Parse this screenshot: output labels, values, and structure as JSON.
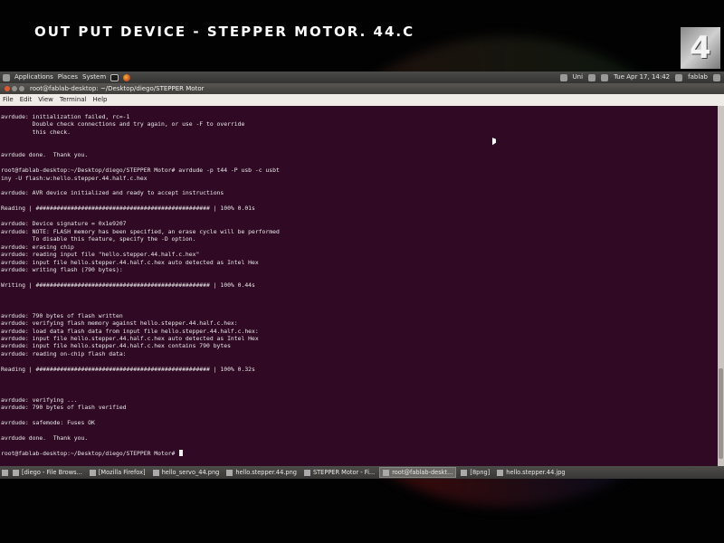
{
  "slide": {
    "title": "OUT PUT DEVICE - STEPPER MOTOR. 44.C",
    "logo_text": "4"
  },
  "top_panel": {
    "menus": [
      "Applications",
      "Places",
      "System"
    ],
    "status": "Uni",
    "datetime": "Tue Apr 17, 14:42",
    "user": "fablab"
  },
  "window": {
    "title": "root@fablab-desktop: ~/Desktop/diego/STEPPER Motor",
    "menu": [
      "File",
      "Edit",
      "View",
      "Terminal",
      "Help"
    ]
  },
  "terminal": {
    "lines": [
      "avrdude: initialization failed, rc=-1",
      "         Double check connections and try again, or use -F to override",
      "         this check.",
      "",
      "",
      "avrdude done.  Thank you.",
      "",
      "root@fablab-desktop:~/Desktop/diego/STEPPER Motor# avrdude -p t44 -P usb -c usbt",
      "iny -U flash:w:hello.stepper.44.half.c.hex",
      "",
      "avrdude: AVR device initialized and ready to accept instructions",
      "",
      "Reading | ################################################## | 100% 0.01s",
      "",
      "avrdude: Device signature = 0x1e9207",
      "avrdude: NOTE: FLASH memory has been specified, an erase cycle will be performed",
      "         To disable this feature, specify the -D option.",
      "avrdude: erasing chip",
      "avrdude: reading input file \"hello.stepper.44.half.c.hex\"",
      "avrdude: input file hello.stepper.44.half.c.hex auto detected as Intel Hex",
      "avrdude: writing flash (790 bytes):",
      "",
      "Writing | ################################################## | 100% 0.44s",
      "",
      "",
      "",
      "avrdude: 790 bytes of flash written",
      "avrdude: verifying flash memory against hello.stepper.44.half.c.hex:",
      "avrdude: load data flash data from input file hello.stepper.44.half.c.hex:",
      "avrdude: input file hello.stepper.44.half.c.hex auto detected as Intel Hex",
      "avrdude: input file hello.stepper.44.half.c.hex contains 790 bytes",
      "avrdude: reading on-chip flash data:",
      "",
      "Reading | ################################################## | 100% 0.32s",
      "",
      "",
      "",
      "avrdude: verifying ...",
      "avrdude: 790 bytes of flash verified",
      "",
      "avrdude: safemode: Fuses OK",
      "",
      "avrdude done.  Thank you.",
      "",
      "root@fablab-desktop:~/Desktop/diego/STEPPER Motor# "
    ]
  },
  "taskbar": {
    "items": [
      {
        "label": "[diego - File Brows...",
        "active": false
      },
      {
        "label": "[Mozilla Firefox]",
        "active": false
      },
      {
        "label": "hello_servo_44.png",
        "active": false
      },
      {
        "label": "hello.stepper.44.png",
        "active": false
      },
      {
        "label": "STEPPER Motor - Fi...",
        "active": false
      },
      {
        "label": "root@fablab-deskt...",
        "active": true
      },
      {
        "label": "[8png]",
        "active": false
      },
      {
        "label": "hello.stepper.44.jpg",
        "active": false
      }
    ]
  }
}
